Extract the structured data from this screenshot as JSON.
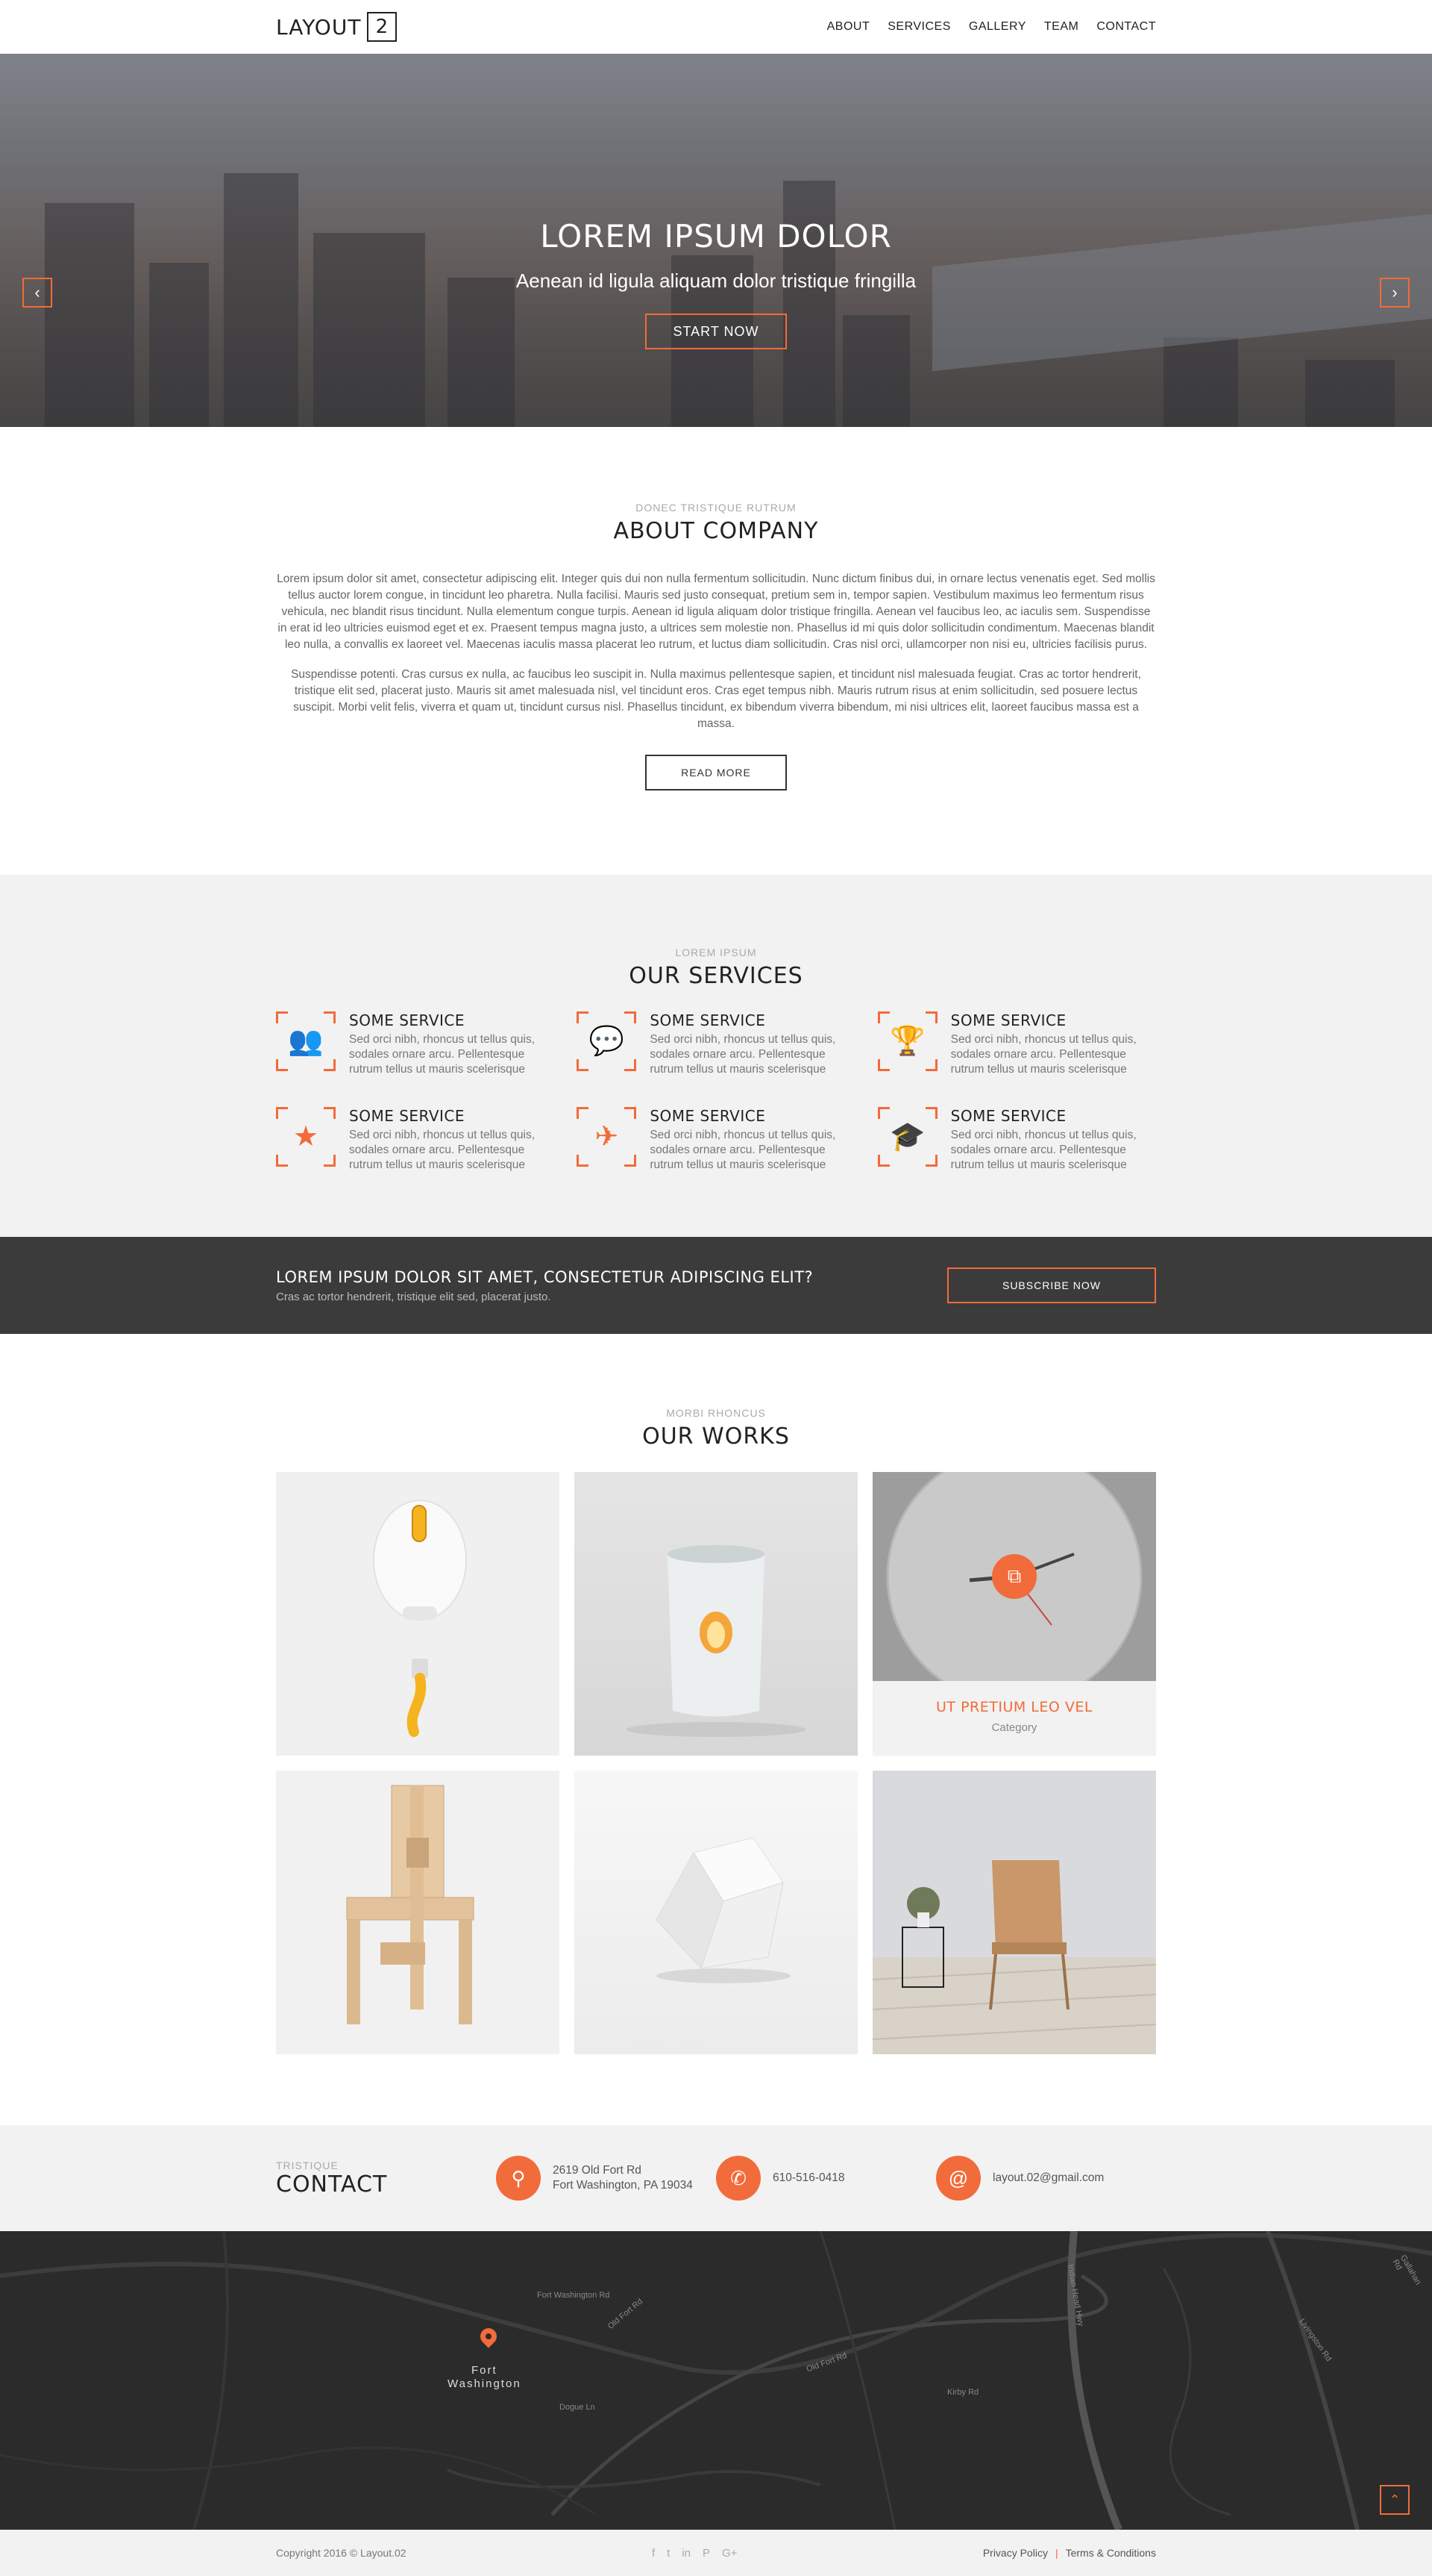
{
  "header": {
    "logo_text": "LAYOUT",
    "logo_num": "2",
    "nav": [
      {
        "label": "ABOUT"
      },
      {
        "label": "SERVICES"
      },
      {
        "label": "GALLERY"
      },
      {
        "label": "TEAM"
      },
      {
        "label": "CONTACT"
      }
    ]
  },
  "hero": {
    "title": "LOREM IPSUM DOLOR",
    "subtitle": "Aenean id ligula aliquam dolor tristique fringilla",
    "button": "START NOW",
    "prev_icon": "chevron-left-icon",
    "next_icon": "chevron-right-icon"
  },
  "about": {
    "subtitle": "DONEC TRISTIQUE RUTRUM",
    "title": "ABOUT COMPANY",
    "paragraph1": "Lorem ipsum dolor sit amet, consectetur adipiscing elit. Integer quis dui non nulla fermentum sollicitudin. Nunc dictum finibus dui, in ornare lectus venenatis eget. Sed mollis tellus auctor lorem congue, in tincidunt leo pharetra. Nulla facilisi. Mauris sed justo consequat, pretium sem in, tempor sapien. Vestibulum maximus leo fermentum risus vehicula, nec blandit risus tincidunt. Nulla elementum congue turpis. Aenean id ligula aliquam dolor tristique fringilla. Aenean vel faucibus leo, ac iaculis sem. Suspendisse in erat id leo ultricies euismod eget et ex. Praesent tempus magna justo, a ultrices sem molestie non. Phasellus id mi quis dolor sollicitudin condimentum. Maecenas blandit leo nulla, a convallis ex laoreet vel. Maecenas iaculis massa placerat leo rutrum, et luctus diam sollicitudin. Cras nisl orci, ullamcorper non nisi eu, ultricies facilisis purus.",
    "paragraph2": "Suspendisse potenti. Cras cursus ex nulla, ac faucibus leo suscipit in. Nulla maximus pellentesque sapien, et tincidunt nisl malesuada feugiat. Cras ac tortor hendrerit, tristique elit sed, placerat justo. Mauris sit amet malesuada nisl, vel tincidunt eros. Cras eget tempus nibh. Mauris rutrum risus at enim sollicitudin, sed posuere lectus suscipit. Morbi velit felis, viverra et quam ut, tincidunt cursus nisl. Phasellus tincidunt, ex bibendum viverra bibendum, mi nisi ultrices elit, laoreet faucibus massa est a massa.",
    "button": "READ MORE"
  },
  "services": {
    "subtitle": "LOREM IPSUM",
    "title": "OUR SERVICES",
    "items": [
      {
        "icon": "users-icon",
        "glyph": "👥",
        "title": "SOME SERVICE",
        "text": "Sed orci nibh, rhoncus ut tellus quis, sodales ornare arcu. Pellentesque rutrum tellus ut mauris scelerisque"
      },
      {
        "icon": "chat-icon",
        "glyph": "💬",
        "title": "SOME SERVICE",
        "text": "Sed orci nibh, rhoncus ut tellus quis, sodales ornare arcu. Pellentesque rutrum tellus ut mauris scelerisque"
      },
      {
        "icon": "trophy-icon",
        "glyph": "🏆",
        "title": "SOME SERVICE",
        "text": "Sed orci nibh, rhoncus ut tellus quis, sodales ornare arcu. Pellentesque rutrum tellus ut mauris scelerisque"
      },
      {
        "icon": "star-icon",
        "glyph": "★",
        "title": "SOME SERVICE",
        "text": "Sed orci nibh, rhoncus ut tellus quis, sodales ornare arcu. Pellentesque rutrum tellus ut mauris scelerisque"
      },
      {
        "icon": "plane-icon",
        "glyph": "✈",
        "title": "SOME SERVICE",
        "text": "Sed orci nibh, rhoncus ut tellus quis, sodales ornare arcu. Pellentesque rutrum tellus ut mauris scelerisque"
      },
      {
        "icon": "graduation-cap-icon",
        "glyph": "🎓",
        "title": "SOME SERVICE",
        "text": "Sed orci nibh, rhoncus ut tellus quis, sodales ornare arcu. Pellentesque rutrum tellus ut mauris scelerisque"
      }
    ]
  },
  "cta": {
    "title": "LOREM IPSUM DOLOR SIT AMET, CONSECTETUR ADIPISCING ELIT?",
    "subtitle": "Cras ac tortor hendrerit, tristique elit sed, placerat justo.",
    "button": "SUBSCRIBE NOW"
  },
  "works": {
    "subtitle": "MORBI RHONCUS",
    "title": "OUR WORKS",
    "items": [
      {
        "name": "work-mouse"
      },
      {
        "name": "work-candle"
      },
      {
        "name": "work-clock",
        "caption_title": "UT PRETIUM LEO VEL",
        "caption_category": "Category",
        "link_icon": "external-link-icon"
      },
      {
        "name": "work-chair"
      },
      {
        "name": "work-cube"
      },
      {
        "name": "work-interior"
      }
    ]
  },
  "contact": {
    "subtitle": "TRISTIQUE",
    "title": "CONTACT",
    "address_line1": "2619 Old Fort Rd",
    "address_line2": "Fort Washington, PA 19034",
    "phone": "610-516-0418",
    "email": "layout.02@gmail.com"
  },
  "map": {
    "town_line1": "Fort",
    "town_line2": "Washington",
    "street_labels": [
      "Old Fort Rd",
      "Fort Washington Rd",
      "Old Fort Rd",
      "Dogue Ln",
      "Kirby Rd",
      "Indian Head Hwy",
      "Livingston Rd",
      "Gallahan Rd"
    ]
  },
  "footer": {
    "copyright": "Copyright 2016 © Layout.02",
    "social": [
      {
        "icon": "facebook-icon",
        "glyph": "f"
      },
      {
        "icon": "twitter-icon",
        "glyph": "t"
      },
      {
        "icon": "linkedin-icon",
        "glyph": "in"
      },
      {
        "icon": "pinterest-icon",
        "glyph": "P"
      },
      {
        "icon": "google-plus-icon",
        "glyph": "G+"
      }
    ],
    "privacy": "Privacy Policy",
    "separator": "|",
    "terms": "Terms & Conditions"
  },
  "colors": {
    "accent": "#f26b3a",
    "dark": "#3b3b3b",
    "light_bg": "#f2f2f2"
  }
}
